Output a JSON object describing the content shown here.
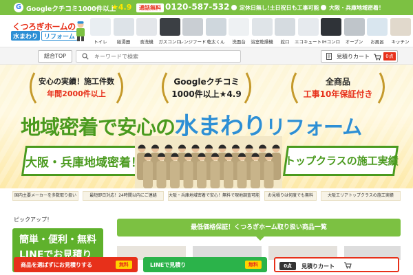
{
  "topbar": {
    "google_label": "Googleクチコミ1000件以上",
    "rating": "★4.9",
    "free_call_label": "通話無料",
    "phone": "0120-587-532",
    "service_note": "定休日無し!土日祝日も工事可能",
    "area_note": "大阪・兵庫地域密着！"
  },
  "logo": {
    "line1": "くつろぎホームの",
    "line2": "水まわり",
    "line3": "リフォーム"
  },
  "categories": [
    {
      "label": "トイレ",
      "color": "#e9eef2"
    },
    {
      "label": "給湯器",
      "color": "#dde3e8"
    },
    {
      "label": "食洗機",
      "color": "#e3e6ea"
    },
    {
      "label": "ガスコンロ",
      "color": "#3b3f44"
    },
    {
      "label": "レンジフード",
      "color": "#c9ced3"
    },
    {
      "label": "乾太くん",
      "color": "#cfd7dd"
    },
    {
      "label": "洗面台",
      "color": "#eef1f3"
    },
    {
      "label": "浴室乾燥機",
      "color": "#dfe4e8"
    },
    {
      "label": "蛇口",
      "color": "#d5dbe0"
    },
    {
      "label": "エコキュート",
      "color": "#e6eaee"
    },
    {
      "label": "IHコンロ",
      "color": "#2f3338"
    },
    {
      "label": "オーブン",
      "color": "#bfc5ca"
    },
    {
      "label": "お風呂",
      "color": "#d9e6ef"
    },
    {
      "label": "キッチン",
      "color": "#e1d9cc"
    }
  ],
  "nav": {
    "home_button": "総合TOP",
    "search_placeholder": "キーワードで検索",
    "cart_label": "見積りカート",
    "cart_count": "0点"
  },
  "hero": {
    "wreath1_line1": "安心の実績！施工件数",
    "wreath1_line2": "年間2000件以上",
    "wreath2_line1": "Googleクチコミ",
    "wreath2_line2": "1000件以上★4.9",
    "wreath3_line1": "全商品",
    "wreath3_line2": "工事10年保証付き",
    "headline_a": "地域密着で安心の",
    "headline_b": "水まわり",
    "headline_c": "リフォーム",
    "banner_left": "大阪・兵庫地域密着！",
    "banner_right": "トップクラスの施工実績"
  },
  "features": [
    "国内主要メーカーを多数取り扱い",
    "最短即日対応！24時間以内にご連絡",
    "大阪・兵庫地域密着で安心！無料で現地調査可能",
    "お見積りは何度でも無料",
    "大阪エリアトップクラスの施工実績"
  ],
  "pickup": {
    "heading": "ピックアップ！",
    "banner_line1": "簡単・便利・無料",
    "banner_line2": "LINEでお見積り"
  },
  "section": {
    "title": "最低価格保証！くつろぎホーム取り扱い商品一覧"
  },
  "footer": {
    "estimate_label": "商品を選ばずにお見積りする",
    "estimate_badge": "無料",
    "line_label": "LINEで見積り",
    "line_badge": "無料",
    "cart_count": "0点",
    "cart_label": "見積りカート"
  },
  "colors": {
    "brand_green": "#7cc142",
    "accent_red": "#e7301a",
    "brand_blue": "#2d8fd5"
  }
}
